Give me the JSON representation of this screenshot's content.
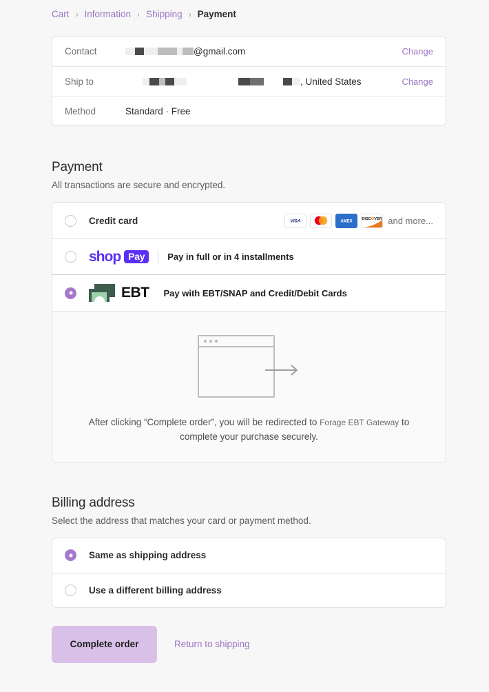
{
  "breadcrumb": {
    "items": [
      {
        "label": "Cart",
        "current": false
      },
      {
        "label": "Information",
        "current": false
      },
      {
        "label": "Shipping",
        "current": false
      },
      {
        "label": "Payment",
        "current": true
      }
    ],
    "separator": "›"
  },
  "summary": {
    "rows": [
      {
        "label": "Contact",
        "value": "@gmail.com",
        "action": "Change"
      },
      {
        "label": "Ship to",
        "value": ", United States",
        "action": "Change"
      },
      {
        "label": "Method",
        "value": "Standard · Free",
        "action": ""
      }
    ]
  },
  "payment": {
    "title": "Payment",
    "subtitle": "All transactions are secure and encrypted.",
    "options": [
      {
        "id": "credit-card",
        "label": "Credit card",
        "selected": false,
        "brands": [
          "VISA",
          "mastercard",
          "AMEX",
          "DISCOVER"
        ],
        "and_more": "and more..."
      },
      {
        "id": "shop-pay",
        "logo_word": "shop",
        "logo_badge": "Pay",
        "description": "Pay in full or in 4 installments",
        "selected": false
      },
      {
        "id": "ebt",
        "logo_word": "EBT",
        "description": "Pay with EBT/SNAP and Credit/Debit Cards",
        "selected": true
      }
    ],
    "redirect": {
      "text_before": "After clicking “Complete order”, you will be redirected to ",
      "gateway": "Forage EBT Gateway",
      "text_after": " to complete your purchase securely."
    }
  },
  "billing": {
    "title": "Billing address",
    "subtitle": "Select the address that matches your card or payment method.",
    "options": [
      {
        "id": "same-as-shipping",
        "label": "Same as shipping address",
        "selected": true
      },
      {
        "id": "different-billing",
        "label": "Use a different billing address",
        "selected": false
      }
    ]
  },
  "actions": {
    "complete_label": "Complete order",
    "return_label": "Return to shipping"
  },
  "colors": {
    "accent": "#9b74c4",
    "radio_selected": "#a678cd",
    "button_bg": "#d8c0e8",
    "shop_pay": "#5a31f4",
    "ebt_green": "#3d5c4c",
    "page_bg": "#f7f7f7"
  }
}
